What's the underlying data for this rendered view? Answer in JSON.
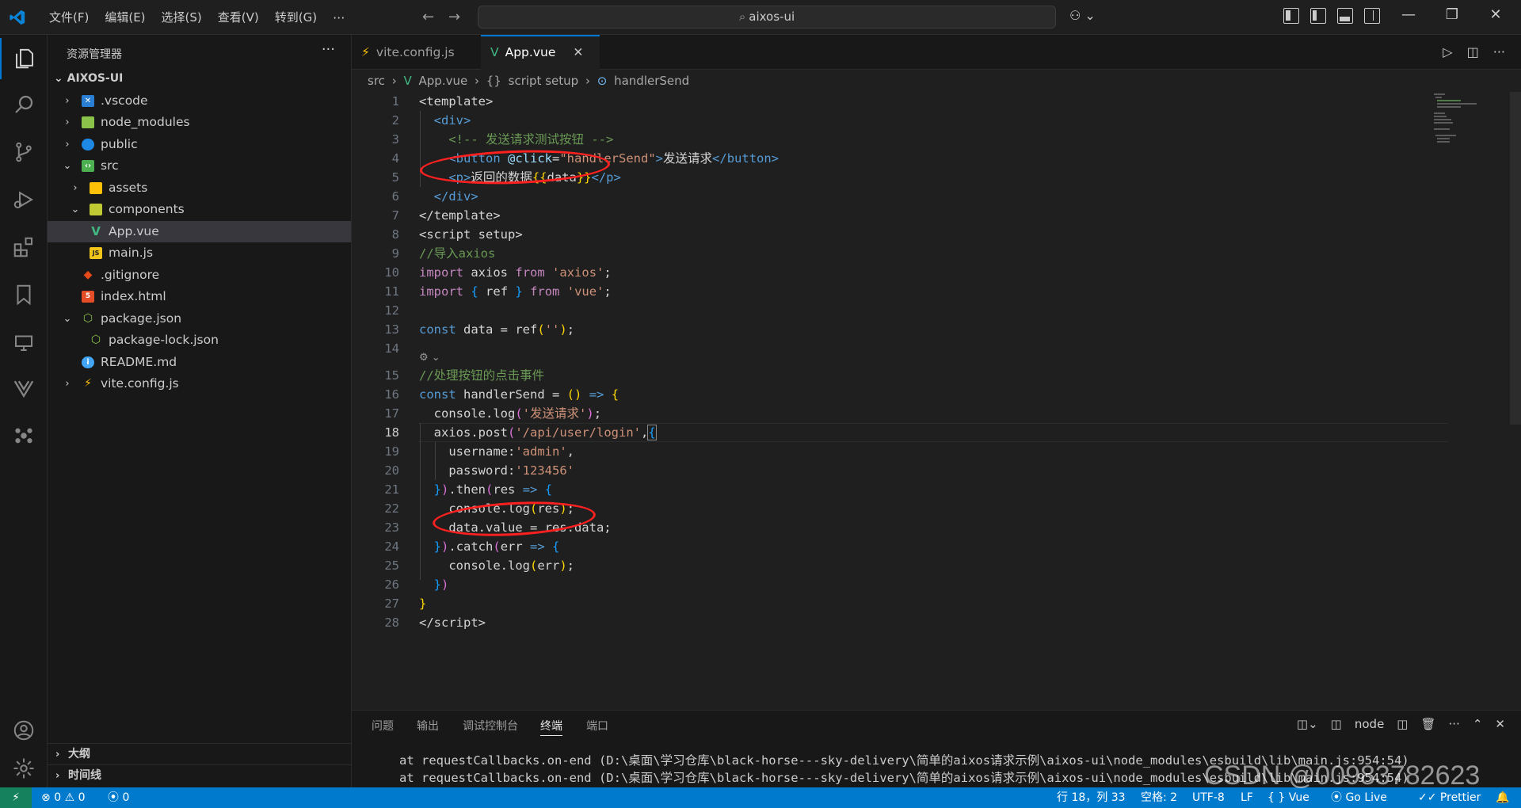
{
  "titlebar": {
    "menu": [
      "文件(F)",
      "编辑(E)",
      "选择(S)",
      "查看(V)",
      "转到(G)"
    ],
    "menu_more": "···",
    "search_text": "aixos-ui",
    "copilot_icon": "copilot-icon"
  },
  "sidebar": {
    "title": "资源管理器",
    "more": "···",
    "root": "AIXOS-UI",
    "items": [
      {
        "label": ".vscode",
        "chev": "›",
        "icon": "vscode-folder-icon"
      },
      {
        "label": "node_modules",
        "chev": "›",
        "icon": "folder-icon"
      },
      {
        "label": "public",
        "chev": "›",
        "icon": "public-folder-icon"
      },
      {
        "label": "src",
        "chev": "⌄",
        "icon": "src-folder-icon"
      },
      {
        "label": "assets",
        "chev": "›",
        "icon": "folder-icon"
      },
      {
        "label": "components",
        "chev": "⌄",
        "icon": "folder-icon"
      },
      {
        "label": "App.vue",
        "chev": "",
        "icon": "vue-icon"
      },
      {
        "label": "main.js",
        "chev": "",
        "icon": "js-icon"
      },
      {
        "label": ".gitignore",
        "chev": "",
        "icon": "git-icon"
      },
      {
        "label": "index.html",
        "chev": "",
        "icon": "html-icon"
      },
      {
        "label": "package.json",
        "chev": "⌄",
        "icon": "nodejs-icon"
      },
      {
        "label": "package-lock.json",
        "chev": "",
        "icon": "nodejs-icon"
      },
      {
        "label": "README.md",
        "chev": "",
        "icon": "info-icon"
      },
      {
        "label": "vite.config.js",
        "chev": "›",
        "icon": "vite-icon"
      }
    ],
    "sections": [
      "大纲",
      "时间线"
    ]
  },
  "tabs": [
    {
      "label": "vite.config.js",
      "icon": "vite-icon"
    },
    {
      "label": "App.vue",
      "icon": "vue-icon",
      "close": "✕"
    }
  ],
  "breadcrumb": [
    "src",
    "App.vue",
    "script setup",
    "handlerSend"
  ],
  "breadcrumb_sep": "›",
  "editor": {
    "line_numbers": [
      "1",
      "2",
      "3",
      "4",
      "5",
      "6",
      "7",
      "8",
      "9",
      "10",
      "11",
      "12",
      "13",
      "14",
      "15",
      "16",
      "17",
      "18",
      "19",
      "20",
      "21",
      "22",
      "23",
      "24",
      "25",
      "26",
      "27",
      "28"
    ],
    "current_line": "18"
  },
  "panel": {
    "tabs": [
      "问题",
      "输出",
      "调试控制台",
      "终端",
      "端口"
    ],
    "active_tab": "终端",
    "terminal_label": "node",
    "terminal_lines": [
      "at requestCallbacks.on-end (D:\\桌面\\学习仓库\\black-horse---sky-delivery\\简单的aixos请求示例\\aixos-ui\\node_modules\\esbuild\\lib\\main.js:954:54)",
      "at requestCallbacks.on-end (D:\\桌面\\学习仓库\\black-horse---sky-delivery\\简单的aixos请求示例\\aixos-ui\\node_modules\\esbuild\\lib\\main.js:954:54)"
    ]
  },
  "statusbar": {
    "errors": "0",
    "warnings": "0",
    "ports": "0",
    "position": "行 18，列 33",
    "spaces": "空格: 2",
    "encoding": "UTF-8",
    "eol": "LF",
    "language": "Vue",
    "golive": "Go Live",
    "prettier": "Prettier"
  },
  "watermark": "CSDN @00983782623"
}
